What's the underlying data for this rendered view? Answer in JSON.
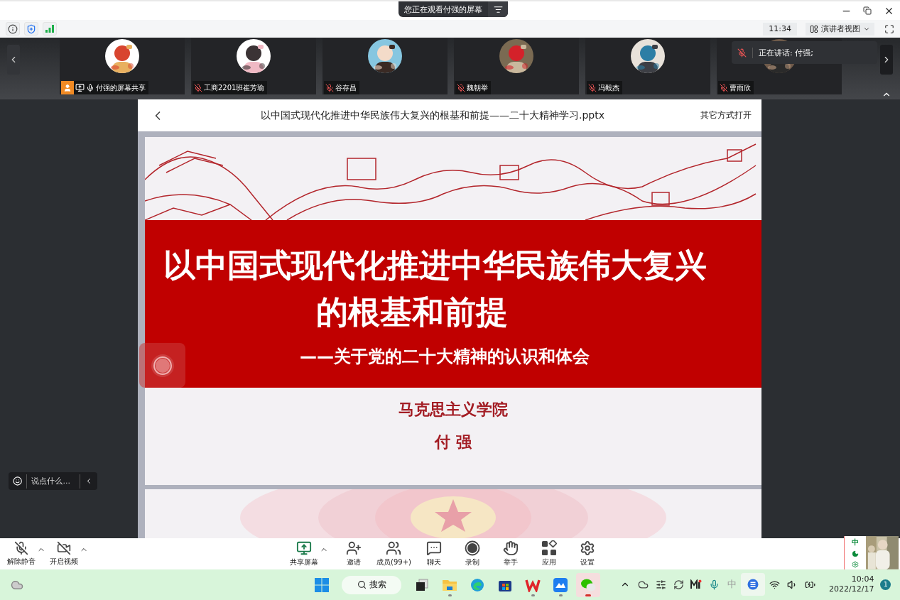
{
  "title_bar": {
    "banner": "您正在观看付强的屏幕"
  },
  "top_bar": {
    "time": "11:34",
    "layout_button": "演讲者视图"
  },
  "participants": [
    {
      "name": "付强的屏幕共享",
      "host": true,
      "sharing": true,
      "muted": false
    },
    {
      "name": "工商2201班崔芳瑜",
      "host": false,
      "sharing": false,
      "muted": true
    },
    {
      "name": "谷存昌",
      "host": false,
      "sharing": false,
      "muted": true
    },
    {
      "name": "魏朝举",
      "host": false,
      "sharing": false,
      "muted": true
    },
    {
      "name": "冯毅杰",
      "host": false,
      "sharing": false,
      "muted": true
    },
    {
      "name": "曹雨欣",
      "host": false,
      "sharing": false,
      "muted": true
    }
  ],
  "speaking_toast": {
    "text": "正在讲话: 付强;",
    "muted": true
  },
  "document": {
    "title": "以中国式现代化推进中华民族伟大复兴的根基和前提——二十大精神学习.pptx",
    "open_with": "其它方式打开",
    "slides": [
      {
        "kind": "title",
        "title_lines": [
          "以中国式现代化推进中华民族伟大复兴",
          "的根基和前提"
        ],
        "subtitle": "——关于党的二十大精神的认识和体会",
        "org": "马克思主义学院",
        "author": "付 强"
      },
      {
        "kind": "emblem"
      }
    ]
  },
  "chat_input": {
    "placeholder": "说点什么..."
  },
  "controls_left": [
    {
      "label": "解除静音",
      "kind": "mic",
      "off": true
    },
    {
      "label": "开启视频",
      "kind": "video",
      "off": true
    }
  ],
  "controls_center": [
    {
      "label": "共享屏幕",
      "kind": "share",
      "caret": true
    },
    {
      "label": "邀请",
      "kind": "invite",
      "caret": false
    },
    {
      "label": "成员(99+)",
      "kind": "members",
      "caret": false
    },
    {
      "label": "聊天",
      "kind": "chat",
      "caret": false
    },
    {
      "label": "录制",
      "kind": "record",
      "caret": false
    },
    {
      "label": "举手",
      "kind": "hand",
      "caret": false
    },
    {
      "label": "应用",
      "kind": "apps",
      "caret": false
    },
    {
      "label": "设置",
      "kind": "settings",
      "caret": false
    }
  ],
  "ime_bar": {
    "mode": "中"
  },
  "taskbar": {
    "search": "搜索",
    "apps": [
      {
        "kind": "taskview",
        "running": false,
        "selected": false
      },
      {
        "kind": "explorer",
        "running": true,
        "selected": false
      },
      {
        "kind": "edge",
        "running": false,
        "selected": false
      },
      {
        "kind": "store",
        "running": false,
        "selected": false
      },
      {
        "kind": "wps",
        "running": true,
        "selected": false
      },
      {
        "kind": "lark",
        "running": true,
        "selected": false
      },
      {
        "kind": "wechat",
        "running": true,
        "selected": true
      }
    ],
    "ime": "中",
    "time": "10:04",
    "date": "2022/12/17",
    "notifications": "1"
  }
}
